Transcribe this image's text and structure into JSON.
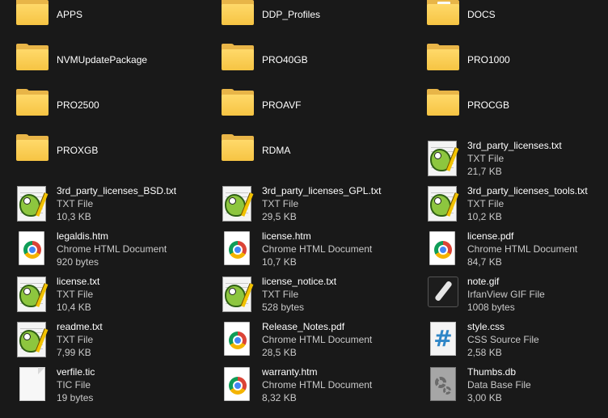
{
  "items": [
    {
      "name": "APPS",
      "type": "",
      "size": "",
      "icon": "folder-icon"
    },
    {
      "name": "DDP_Profiles",
      "type": "",
      "size": "",
      "icon": "folder-icon"
    },
    {
      "name": "DOCS",
      "type": "",
      "size": "",
      "icon": "folder-doc-icon"
    },
    {
      "name": "NVMUpdatePackage",
      "type": "",
      "size": "",
      "icon": "folder-icon"
    },
    {
      "name": "PRO40GB",
      "type": "",
      "size": "",
      "icon": "folder-icon"
    },
    {
      "name": "PRO1000",
      "type": "",
      "size": "",
      "icon": "folder-icon"
    },
    {
      "name": "PRO2500",
      "type": "",
      "size": "",
      "icon": "folder-icon"
    },
    {
      "name": "PROAVF",
      "type": "",
      "size": "",
      "icon": "folder-icon"
    },
    {
      "name": "PROCGB",
      "type": "",
      "size": "",
      "icon": "folder-icon"
    },
    {
      "name": "PROXGB",
      "type": "",
      "size": "",
      "icon": "folder-icon"
    },
    {
      "name": "RDMA",
      "type": "",
      "size": "",
      "icon": "folder-icon"
    },
    {
      "name": "3rd_party_licenses.txt",
      "type": "TXT File",
      "size": "21,7 KB",
      "icon": "notepad-plus-plus-icon"
    },
    {
      "name": "3rd_party_licenses_BSD.txt",
      "type": "TXT File",
      "size": "10,3 KB",
      "icon": "notepad-plus-plus-icon"
    },
    {
      "name": "3rd_party_licenses_GPL.txt",
      "type": "TXT File",
      "size": "29,5 KB",
      "icon": "notepad-plus-plus-icon"
    },
    {
      "name": "3rd_party_licenses_tools.txt",
      "type": "TXT File",
      "size": "10,2 KB",
      "icon": "notepad-plus-plus-icon"
    },
    {
      "name": "legaldis.htm",
      "type": "Chrome HTML Document",
      "size": "920 bytes",
      "icon": "chrome-html-icon"
    },
    {
      "name": "license.htm",
      "type": "Chrome HTML Document",
      "size": "10,7 KB",
      "icon": "chrome-html-icon"
    },
    {
      "name": "license.pdf",
      "type": "Chrome HTML Document",
      "size": "84,7 KB",
      "icon": "chrome-html-icon"
    },
    {
      "name": "license.txt",
      "type": "TXT File",
      "size": "10,4 KB",
      "icon": "notepad-plus-plus-icon"
    },
    {
      "name": "license_notice.txt",
      "type": "TXT File",
      "size": "528 bytes",
      "icon": "notepad-plus-plus-icon"
    },
    {
      "name": "note.gif",
      "type": "IrfanView GIF File",
      "size": "1008 bytes",
      "icon": "irfanview-gif-icon"
    },
    {
      "name": "readme.txt",
      "type": "TXT File",
      "size": "7,99 KB",
      "icon": "notepad-plus-plus-icon"
    },
    {
      "name": "Release_Notes.pdf",
      "type": "Chrome HTML Document",
      "size": "28,5 KB",
      "icon": "chrome-html-icon"
    },
    {
      "name": "style.css",
      "type": "CSS Source File",
      "size": "2,58 KB",
      "icon": "css-file-icon"
    },
    {
      "name": "verfile.tic",
      "type": "TIC File",
      "size": "19 bytes",
      "icon": "generic-file-icon"
    },
    {
      "name": "warranty.htm",
      "type": "Chrome HTML Document",
      "size": "8,32 KB",
      "icon": "chrome-html-icon"
    },
    {
      "name": "Thumbs.db",
      "type": "Data Base File",
      "size": "3,00 KB",
      "icon": "database-file-icon"
    }
  ]
}
